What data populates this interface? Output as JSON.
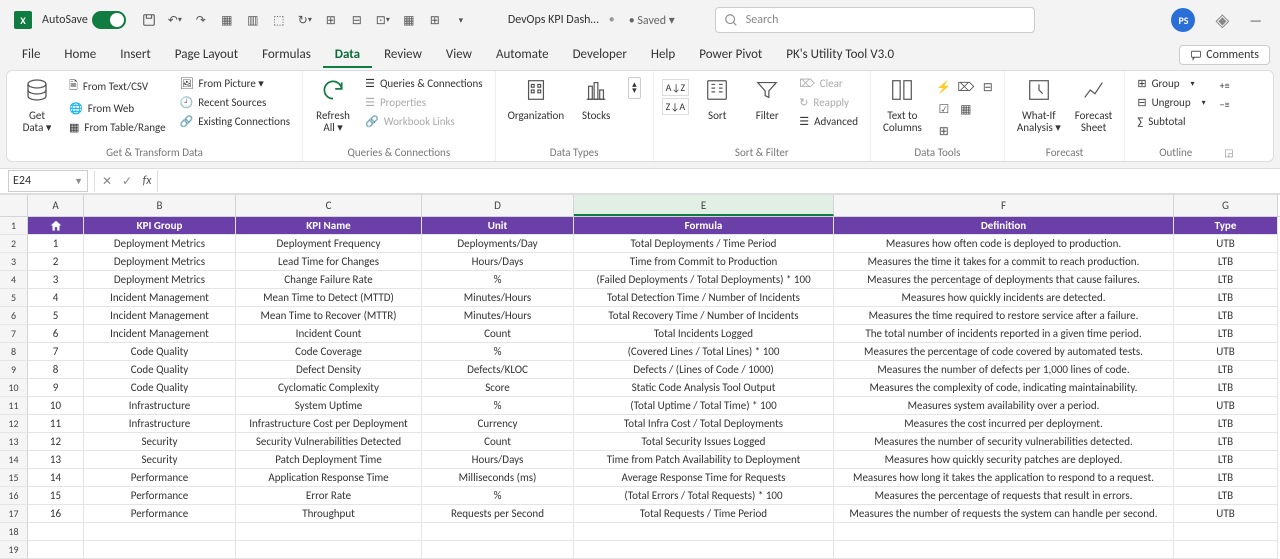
{
  "title": {
    "autosave_label": "AutoSave",
    "filename": "DevOps KPI Dash…",
    "saved_label": "• Saved ▾",
    "search_placeholder": "Search",
    "user_initials": "PS"
  },
  "tabs": [
    "File",
    "Home",
    "Insert",
    "Page Layout",
    "Formulas",
    "Data",
    "Review",
    "View",
    "Automate",
    "Developer",
    "Help",
    "Power Pivot",
    "PK's Utility Tool V3.0"
  ],
  "active_tab": "Data",
  "comments_label": "Comments",
  "ribbon": {
    "get_transform": {
      "get_data": "Get\nData ▾",
      "from_text": "From Text/CSV",
      "from_web": "From Web",
      "from_table": "From Table/Range",
      "from_picture": "From Picture ▾",
      "recent_sources": "Recent Sources",
      "existing_conn": "Existing Connections",
      "label": "Get & Transform Data"
    },
    "queries": {
      "refresh": "Refresh\nAll ▾",
      "qc": "Queries & Connections",
      "props": "Properties",
      "wl": "Workbook Links",
      "label": "Queries & Connections"
    },
    "datatypes": {
      "org": "Organization",
      "stocks": "Stocks",
      "label": "Data Types"
    },
    "sortfilter": {
      "sort": "Sort",
      "filter": "Filter",
      "clear": "Clear",
      "reapply": "Reapply",
      "advanced": "Advanced",
      "label": "Sort & Filter"
    },
    "datatools": {
      "t2c": "Text to\nColumns",
      "label": "Data Tools"
    },
    "forecast": {
      "whatif": "What-If\nAnalysis ▾",
      "fsheet": "Forecast\nSheet",
      "label": "Forecast"
    },
    "outline": {
      "group": "Group",
      "ungroup": "Ungroup",
      "subtotal": "Subtotal",
      "label": "Outline"
    }
  },
  "namebox": "E24",
  "columns": [
    "A",
    "B",
    "C",
    "D",
    "E",
    "F",
    "G"
  ],
  "header_row": [
    "#",
    "KPI Group",
    "KPI Name",
    "Unit",
    "Formula",
    "Definition",
    "Type"
  ],
  "rows": [
    [
      "1",
      "Deployment Metrics",
      "Deployment Frequency",
      "Deployments/Day",
      "Total Deployments / Time Period",
      "Measures how often code is deployed to production.",
      "UTB"
    ],
    [
      "2",
      "Deployment Metrics",
      "Lead Time for Changes",
      "Hours/Days",
      "Time from Commit to Production",
      "Measures the time it takes for a commit to reach production.",
      "LTB"
    ],
    [
      "3",
      "Deployment Metrics",
      "Change Failure Rate",
      "%",
      "(Failed Deployments / Total Deployments) * 100",
      "Measures the percentage of deployments that cause failures.",
      "LTB"
    ],
    [
      "4",
      "Incident Management",
      "Mean Time to Detect (MTTD)",
      "Minutes/Hours",
      "Total Detection Time / Number of Incidents",
      "Measures how quickly incidents are detected.",
      "LTB"
    ],
    [
      "5",
      "Incident Management",
      "Mean Time to Recover (MTTR)",
      "Minutes/Hours",
      "Total Recovery Time / Number of Incidents",
      "Measures the time required to restore service after a failure.",
      "LTB"
    ],
    [
      "6",
      "Incident Management",
      "Incident Count",
      "Count",
      "Total Incidents Logged",
      "The total number of incidents reported in a given time period.",
      "LTB"
    ],
    [
      "7",
      "Code Quality",
      "Code Coverage",
      "%",
      "(Covered Lines / Total Lines) * 100",
      "Measures the percentage of code covered by automated tests.",
      "UTB"
    ],
    [
      "8",
      "Code Quality",
      "Defect Density",
      "Defects/KLOC",
      "Defects / (Lines of Code / 1000)",
      "Measures the number of defects per 1,000 lines of code.",
      "LTB"
    ],
    [
      "9",
      "Code Quality",
      "Cyclomatic Complexity",
      "Score",
      "Static Code Analysis Tool Output",
      "Measures the complexity of code, indicating maintainability.",
      "LTB"
    ],
    [
      "10",
      "Infrastructure",
      "System Uptime",
      "%",
      "(Total Uptime / Total Time) * 100",
      "Measures system availability over a period.",
      "UTB"
    ],
    [
      "11",
      "Infrastructure",
      "Infrastructure Cost per Deployment",
      "Currency",
      "Total Infra Cost / Total Deployments",
      "Measures the cost incurred per deployment.",
      "LTB"
    ],
    [
      "12",
      "Security",
      "Security Vulnerabilities Detected",
      "Count",
      "Total Security Issues Logged",
      "Measures the number of security vulnerabilities detected.",
      "LTB"
    ],
    [
      "13",
      "Security",
      "Patch Deployment Time",
      "Hours/Days",
      "Time from Patch Availability to Deployment",
      "Measures how quickly security patches are deployed.",
      "LTB"
    ],
    [
      "14",
      "Performance",
      "Application Response Time",
      "Milliseconds (ms)",
      "Average Response Time for Requests",
      "Measures how long it takes the application to respond to a request.",
      "LTB"
    ],
    [
      "15",
      "Performance",
      "Error Rate",
      "%",
      "(Total Errors / Total Requests) * 100",
      "Measures the percentage of requests that result in errors.",
      "LTB"
    ],
    [
      "16",
      "Performance",
      "Throughput",
      "Requests per Second",
      "Total Requests / Time Period",
      "Measures the number of requests the system can handle per second.",
      "UTB"
    ]
  ],
  "row_numbers": [
    "1",
    "2",
    "3",
    "4",
    "5",
    "6",
    "7",
    "8",
    "9",
    "10",
    "11",
    "12",
    "13",
    "14",
    "15",
    "16",
    "17",
    "18",
    "19"
  ]
}
